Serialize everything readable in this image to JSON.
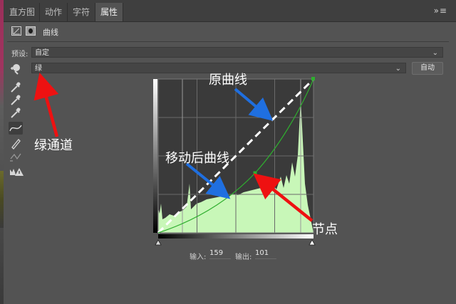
{
  "tabs": [
    {
      "label": "直方图"
    },
    {
      "label": "动作"
    },
    {
      "label": "字符"
    },
    {
      "label": "属性"
    }
  ],
  "tabs_menu_glyph": "»≡",
  "panel": {
    "title": "曲线",
    "preset_label": "预设:",
    "preset_value": "自定",
    "channel_value": "绿",
    "auto_label": "自动"
  },
  "io": {
    "input_label": "输入:",
    "input_value": "159",
    "output_label": "输出:",
    "output_value": "101"
  },
  "annotations": {
    "original_curve": "原曲线",
    "moved_curve": "移动后曲线",
    "green_channel": "绿通道",
    "node": "节点"
  },
  "colors": {
    "panel_bg": "#535353",
    "histogram_fill": "#c8f7b8",
    "curve_green": "#2fae2f",
    "arrow_blue": "#1f6fe0",
    "arrow_red": "#ee1111"
  },
  "icons": {
    "curves": "curves-icon",
    "mask": "mask-icon",
    "hand": "on-image-adjust-icon",
    "eyedropper": "eyedropper-icon",
    "curve_tool": "curve-point-icon",
    "pencil": "pencil-icon",
    "smooth": "smooth-icon",
    "clip": "clipping-warning-icon"
  }
}
